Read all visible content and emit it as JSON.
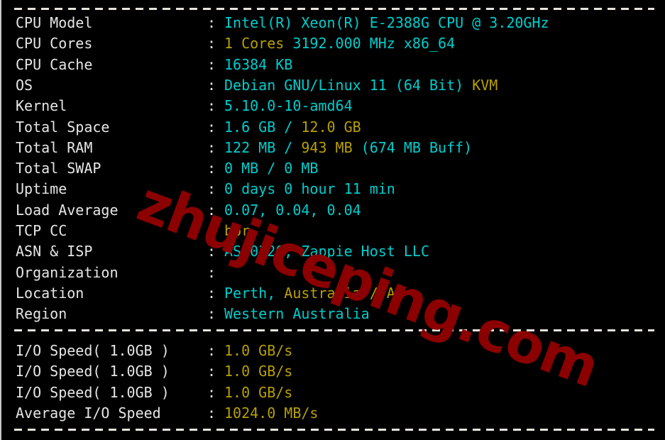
{
  "terminal": {
    "separator_char": "-",
    "colon": ":",
    "watermark": "zhujiceping.com",
    "colors": {
      "background": "#000000",
      "label": "#e6e6e6",
      "cyan": "#00cdcd",
      "yellow": "#b8a000",
      "watermark": "#8b0000",
      "separator": "#e8e4dc"
    }
  },
  "system_info": [
    {
      "label": "CPU Model",
      "parts": [
        {
          "text": "Intel(R) Xeon(R) E-2388G CPU @ 3.20GHz",
          "color": "cyan"
        }
      ]
    },
    {
      "label": "CPU Cores",
      "parts": [
        {
          "text": "1 Cores",
          "color": "yellow"
        },
        {
          "text": " 3192.000 MHz x86_64",
          "color": "cyan"
        }
      ]
    },
    {
      "label": "CPU Cache",
      "parts": [
        {
          "text": "16384 KB",
          "color": "cyan"
        }
      ]
    },
    {
      "label": "OS",
      "parts": [
        {
          "text": "Debian GNU/Linux 11 (64 Bit)",
          "color": "cyan"
        },
        {
          "text": " KVM",
          "color": "yellow"
        }
      ]
    },
    {
      "label": "Kernel",
      "parts": [
        {
          "text": "5.10.0-10-amd64",
          "color": "cyan"
        }
      ]
    },
    {
      "label": "Total Space",
      "parts": [
        {
          "text": "1.6 GB ",
          "color": "cyan"
        },
        {
          "text": "/",
          "color": "cyan"
        },
        {
          "text": " 12.0 GB",
          "color": "yellow"
        }
      ]
    },
    {
      "label": "Total RAM",
      "parts": [
        {
          "text": "122 MB ",
          "color": "cyan"
        },
        {
          "text": "/",
          "color": "cyan"
        },
        {
          "text": " 943 MB",
          "color": "yellow"
        },
        {
          "text": " (674 MB Buff)",
          "color": "cyan"
        }
      ]
    },
    {
      "label": "Total SWAP",
      "parts": [
        {
          "text": "0 MB / 0 MB",
          "color": "cyan"
        }
      ]
    },
    {
      "label": "Uptime",
      "parts": [
        {
          "text": "0 days 0 hour 11 min",
          "color": "cyan"
        }
      ]
    },
    {
      "label": "Load Average",
      "parts": [
        {
          "text": "0.07, 0.04, 0.04",
          "color": "cyan"
        }
      ]
    },
    {
      "label": "TCP CC",
      "parts": [
        {
          "text": "bbr",
          "color": "yellow"
        }
      ]
    },
    {
      "label": "ASN & ISP",
      "parts": [
        {
          "text": "AS20326, Zappie Host LLC",
          "color": "cyan"
        }
      ]
    },
    {
      "label": "Organization",
      "parts": [
        {
          "text": "",
          "color": "cyan"
        }
      ]
    },
    {
      "label": "Location",
      "parts": [
        {
          "text": "Perth,",
          "color": "cyan"
        },
        {
          "text": " Australia / AU",
          "color": "yellow"
        }
      ]
    },
    {
      "label": "Region",
      "parts": [
        {
          "text": "Western Australia",
          "color": "cyan"
        }
      ]
    }
  ],
  "io_results": [
    {
      "label": "I/O Speed( 1.0GB )",
      "parts": [
        {
          "text": "1.0 GB/s",
          "color": "yellow"
        }
      ]
    },
    {
      "label": "I/O Speed( 1.0GB )",
      "parts": [
        {
          "text": "1.0 GB/s",
          "color": "yellow"
        }
      ]
    },
    {
      "label": "I/O Speed( 1.0GB )",
      "parts": [
        {
          "text": "1.0 GB/s",
          "color": "yellow"
        }
      ]
    },
    {
      "label": "Average I/O Speed",
      "parts": [
        {
          "text": "1024.0 MB/s",
          "color": "yellow"
        }
      ]
    }
  ]
}
